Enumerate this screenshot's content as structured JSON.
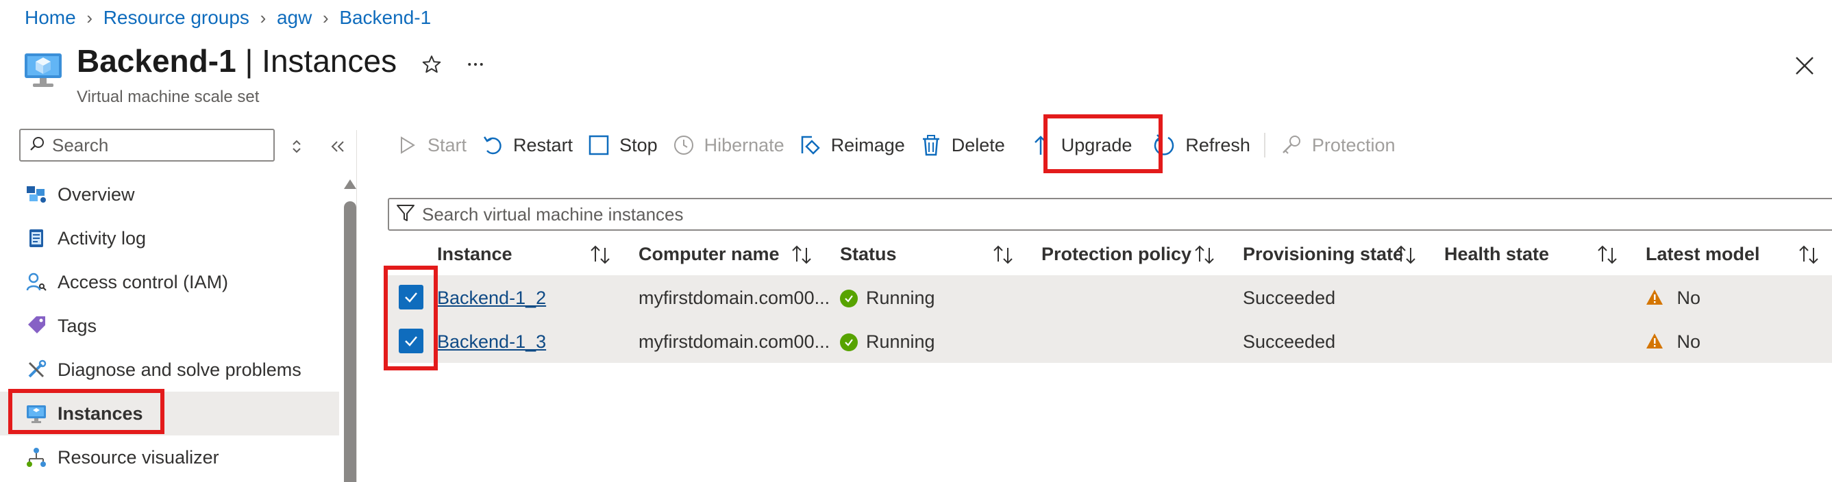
{
  "breadcrumb": [
    "Home",
    "Resource groups",
    "agw",
    "Backend-1"
  ],
  "header": {
    "resource_name": "Backend-1",
    "separator": "|",
    "section": "Instances",
    "subtitle": "Virtual machine scale set",
    "favorite_icon": "star-icon",
    "more_icon": "more-icon",
    "close_icon": "close-icon"
  },
  "sidebar": {
    "search_placeholder": "Search",
    "items": [
      {
        "label": "Overview",
        "icon": "overview-icon"
      },
      {
        "label": "Activity log",
        "icon": "activity-log-icon"
      },
      {
        "label": "Access control (IAM)",
        "icon": "iam-icon"
      },
      {
        "label": "Tags",
        "icon": "tag-icon"
      },
      {
        "label": "Diagnose and solve problems",
        "icon": "wrench-icon"
      },
      {
        "label": "Instances",
        "icon": "monitor-icon",
        "selected": true
      },
      {
        "label": "Resource visualizer",
        "icon": "visualizer-icon"
      }
    ]
  },
  "toolbar": {
    "start": "Start",
    "restart": "Restart",
    "stop": "Stop",
    "hibernate": "Hibernate",
    "reimage": "Reimage",
    "delete": "Delete",
    "upgrade": "Upgrade",
    "refresh": "Refresh",
    "protection": "Protection"
  },
  "filter": {
    "placeholder": "Search virtual machine instances"
  },
  "table": {
    "columns": [
      "Instance",
      "Computer name",
      "Status",
      "Protection policy",
      "Provisioning state",
      "Health state",
      "Latest model"
    ],
    "rows": [
      {
        "instance": "Backend-1_2",
        "computer_name": "myfirstdomain.com00...",
        "status": "Running",
        "protection_policy": "",
        "provisioning_state": "Succeeded",
        "health_state": "",
        "latest_model": "No",
        "checked": true
      },
      {
        "instance": "Backend-1_3",
        "computer_name": "myfirstdomain.com00...",
        "status": "Running",
        "protection_policy": "",
        "provisioning_state": "Succeeded",
        "health_state": "",
        "latest_model": "No",
        "checked": true
      }
    ]
  },
  "colors": {
    "accent": "#0f6cbd",
    "highlight_box": "#e31b1b",
    "success": "#57a300",
    "warning": "#d47500",
    "selected_bg": "#edebe9"
  }
}
